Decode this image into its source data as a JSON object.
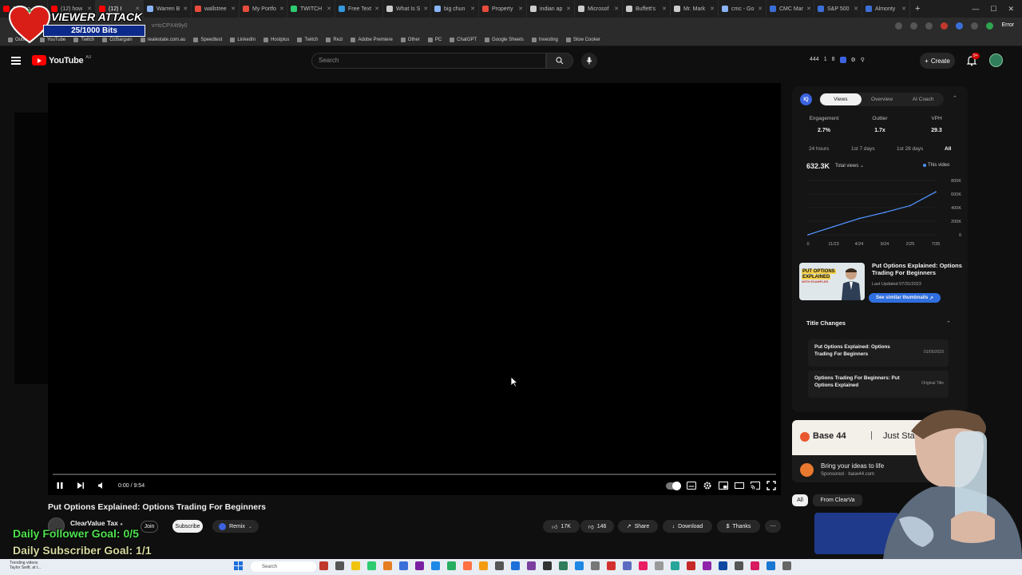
{
  "browser": {
    "tabs": [
      {
        "title": "(12) ho",
        "color": "#ff0000"
      },
      {
        "title": "(12) how",
        "color": "#ff0000"
      },
      {
        "title": "(12) I",
        "color": "#ff0000",
        "active": true
      },
      {
        "title": "Warren B",
        "color": "#8ab4f8"
      },
      {
        "title": "wallstree",
        "color": "#e74c3c"
      },
      {
        "title": "My Portfo",
        "color": "#e74c3c"
      },
      {
        "title": "TWITCH",
        "color": "#2ecc71"
      },
      {
        "title": "Free Text",
        "color": "#3498db"
      },
      {
        "title": "What Is S",
        "color": "#cccccc"
      },
      {
        "title": "big chun",
        "color": "#8ab4f8"
      },
      {
        "title": "Property",
        "color": "#e74c3c"
      },
      {
        "title": "indian ap",
        "color": "#cccccc"
      },
      {
        "title": "Microsof",
        "color": "#cccccc"
      },
      {
        "title": "Buffett's",
        "color": "#cccccc"
      },
      {
        "title": "Mr. Mark",
        "color": "#cccccc"
      },
      {
        "title": "cmc - Go",
        "color": "#8ab4f8"
      },
      {
        "title": "CMC Mar",
        "color": "#3b6fd8"
      },
      {
        "title": "S&P 500",
        "color": "#3b6fd8"
      },
      {
        "title": "Almonty",
        "color": "#3b6fd8"
      }
    ],
    "new_tab": "+",
    "url": "v=tcCPX4t9y0",
    "error_label": "Error",
    "bookmarks": [
      "Outlook",
      "YouTube",
      "Twitch",
      "OzBargain",
      "realestate.com.au",
      "Speedtest",
      "LinkedIn",
      "Hostplus",
      "Twitch",
      "Rezi",
      "Adobe Premiere",
      "Other",
      "PC",
      "ChatGPT",
      "Google Sheets",
      "Investing",
      "Slow Cooker"
    ]
  },
  "overlay": {
    "title": "VIEWER ATTACK",
    "bits": "25/1000 Bits",
    "follower_goal": "Daily Follower Goal: 0/5",
    "subscriber_goal": "Daily Subscriber Goal: 1/1"
  },
  "youtube": {
    "logo": "YouTube",
    "region": "AU",
    "search_placeholder": "Search",
    "mini_stats": [
      "444",
      "1",
      "8"
    ],
    "create_label": "Create",
    "notif_badge": "9+"
  },
  "player": {
    "time": "0:00 / 9:54",
    "progress": 0
  },
  "video": {
    "title": "Put Options Explained: Options Trading For Beginners",
    "channel": "ClearValue Tax",
    "join": "Join",
    "subscribe": "Subscribe",
    "remix": "Remix",
    "likes": "17K",
    "dislikes": "146",
    "share": "Share",
    "download": "Download",
    "thanks": "Thanks"
  },
  "analytics": {
    "logo": "IQ",
    "tabs": [
      "Views",
      "Overview",
      "AI Coach"
    ],
    "metrics": [
      {
        "label": "Engagement",
        "value": "2.7%"
      },
      {
        "label": "Outlier",
        "value": "1.7x"
      },
      {
        "label": "VPH",
        "value": "29.3"
      }
    ],
    "ranges": [
      "24 hours",
      "1st 7 days",
      "1st 28 days",
      "All"
    ],
    "total": "632.3K",
    "total_dropdown": "Total views",
    "legend": "This video",
    "chart_data": {
      "type": "line",
      "x": [
        "0",
        "11/23",
        "4/24",
        "9/24",
        "2/25",
        "7/25"
      ],
      "series": [
        {
          "name": "This video",
          "values": [
            0,
            120000,
            240000,
            330000,
            430000,
            632300
          ]
        }
      ],
      "yticks": [
        "0",
        "200K",
        "400K",
        "600K",
        "800K"
      ],
      "ylim": [
        0,
        800000
      ]
    },
    "thumb_text_a": "PUT OPTIONS",
    "thumb_text_b": "EXPLAINED",
    "thumb_text_c": "WITH EXAMPLES",
    "thumb_title": "Put Options Explained: Options Trading For Beginners",
    "thumb_date": "Last Updated 07/31/2023",
    "similar": "See similar thumbnails",
    "title_changes_head": "Title Changes",
    "title_changes": [
      {
        "title": "Put Options Explained: Options Trading For Beginners",
        "date": "01/05/2023"
      },
      {
        "title": "Options Trading For Beginners: Put Options Explained",
        "date": "Original Title"
      }
    ]
  },
  "ad": {
    "brand": "Base 44",
    "tagline": "Just Start",
    "line": "Bring your ideas to life",
    "sponsored": "Sponsored · base44.com"
  },
  "chips": [
    "All",
    "From ClearVa"
  ],
  "taskbar": {
    "news_a": "Trending videos",
    "news_b": "Taylor Swift, at t...",
    "search": "Search"
  }
}
